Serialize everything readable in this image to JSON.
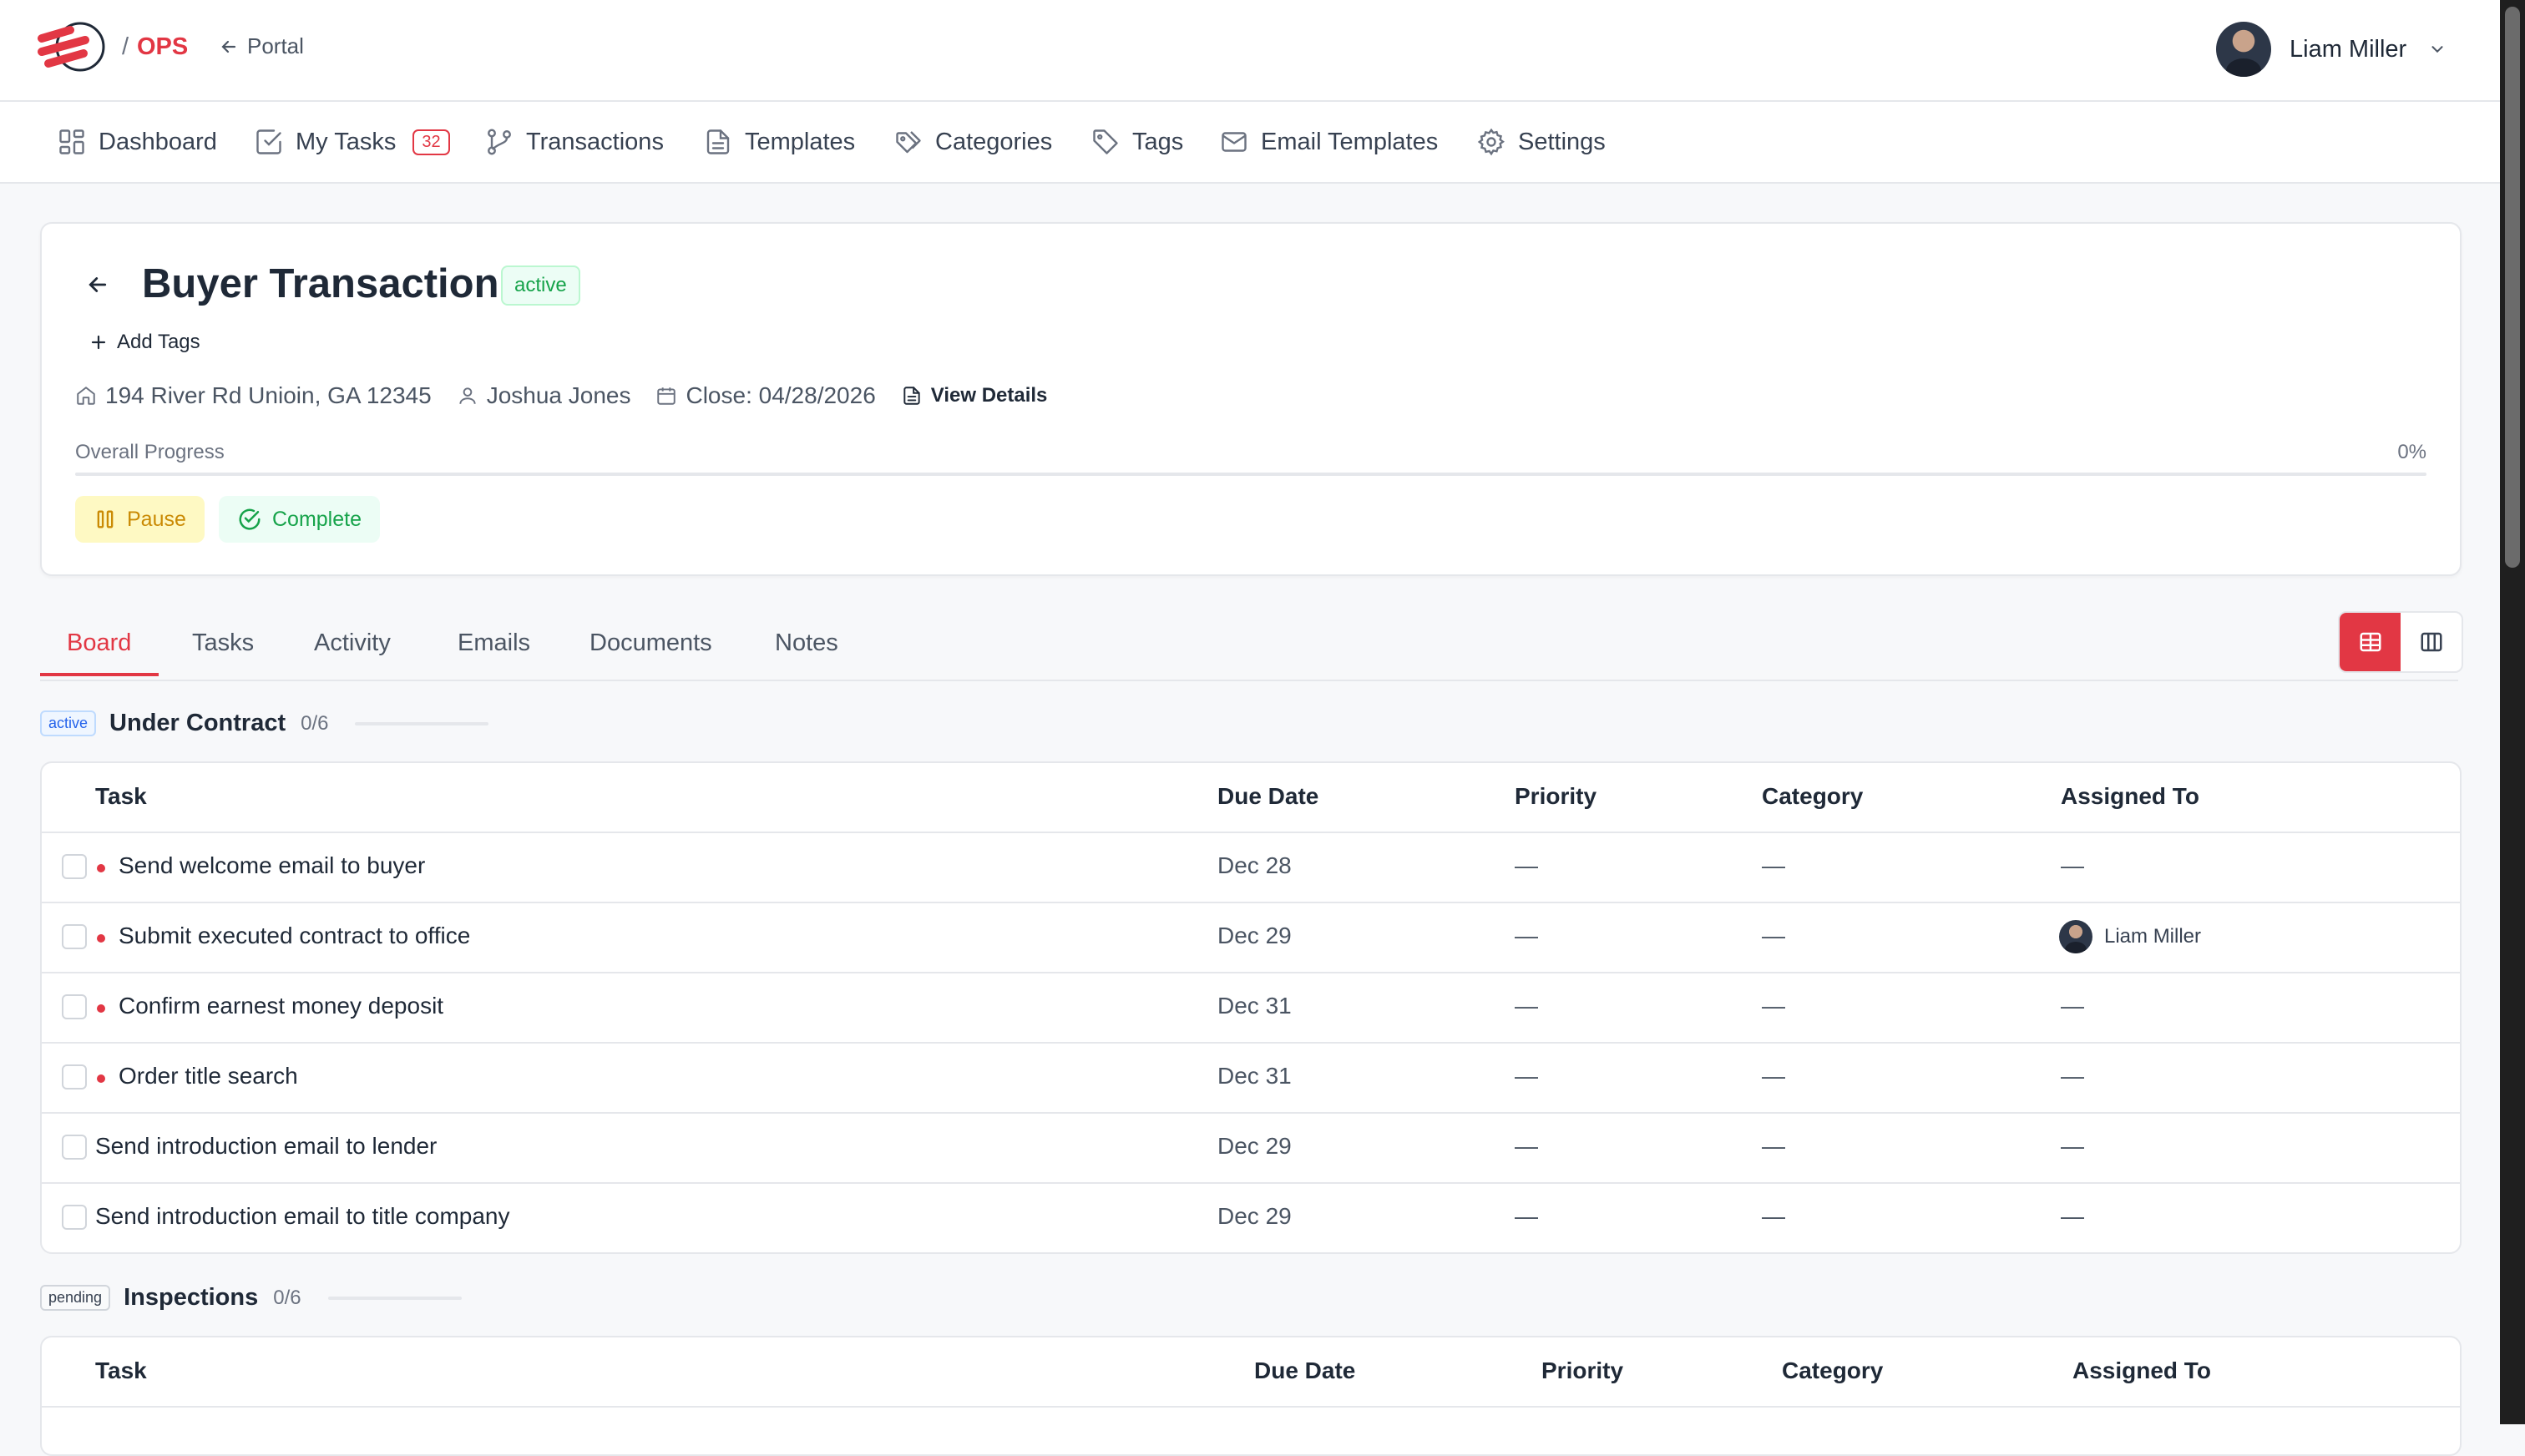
{
  "brand": {
    "separator": "/",
    "name": "OPS",
    "accent": "#e23744"
  },
  "portal": {
    "label": "Portal"
  },
  "user": {
    "name": "Liam Miller"
  },
  "nav": {
    "dashboard": "Dashboard",
    "my_tasks": "My Tasks",
    "my_tasks_count": "32",
    "transactions": "Transactions",
    "templates": "Templates",
    "categories": "Categories",
    "tags": "Tags",
    "email_templates": "Email Templates",
    "settings": "Settings"
  },
  "transaction": {
    "title": "Buyer Transaction",
    "status": "active",
    "add_tags": "Add Tags",
    "address": "194 River Rd Unioin, GA 12345",
    "client": "Joshua Jones",
    "close": "Close: 04/28/2026",
    "view_details": "View Details",
    "progress_label": "Overall Progress",
    "progress_value": "0%",
    "progress_fraction": 0,
    "pause": "Pause",
    "complete": "Complete"
  },
  "tabs": [
    "Board",
    "Tasks",
    "Activity",
    "Emails",
    "Documents",
    "Notes"
  ],
  "stages": [
    {
      "badge": "active",
      "name": "Under Contract",
      "count": "0/6",
      "columns": {
        "task": "Task",
        "due": "Due Date",
        "priority": "Priority",
        "category": "Category",
        "assigned": "Assigned To"
      },
      "rows": [
        {
          "task": "Send welcome email to buyer",
          "due": "Dec 28",
          "priority": "—",
          "category": "—",
          "assigned": "—"
        },
        {
          "task": "Submit executed contract to office",
          "due": "Dec 29",
          "priority": "—",
          "category": "—",
          "assigned": "Liam Miller"
        },
        {
          "task": "Confirm earnest money deposit",
          "due": "Dec 31",
          "priority": "—",
          "category": "—",
          "assigned": "—"
        },
        {
          "task": "Order title search",
          "due": "Dec 31",
          "priority": "—",
          "category": "—",
          "assigned": "—"
        },
        {
          "task": "Send introduction email to lender",
          "due": "Dec 29",
          "priority": "—",
          "category": "—",
          "assigned": "—"
        },
        {
          "task": "Send introduction email to title company",
          "due": "Dec 29",
          "priority": "—",
          "category": "—",
          "assigned": "—"
        }
      ]
    },
    {
      "badge": "pending",
      "name": "Inspections",
      "count": "0/6",
      "columns": {
        "task": "Task",
        "due": "Due Date",
        "priority": "Priority",
        "category": "Category",
        "assigned": "Assigned To"
      }
    }
  ]
}
